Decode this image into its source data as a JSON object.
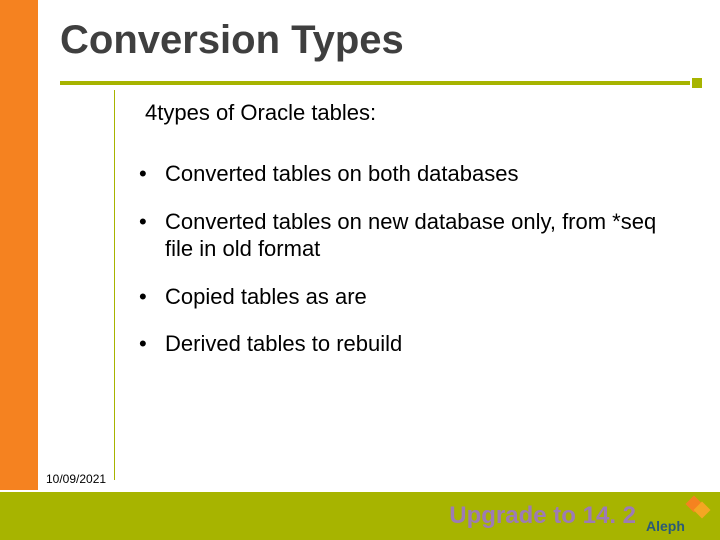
{
  "title": "Conversion Types",
  "intro_prefix": "4",
  "intro_rest": "types of Oracle tables:",
  "bullets": [
    "Converted tables on both databases",
    "Converted tables on new database only, from *seq file in old format",
    "Copied tables as are",
    "Derived tables to rebuild"
  ],
  "footer": {
    "date": "10/09/2021",
    "tagline": "Upgrade to 14. 2",
    "logo_text": "Aleph"
  },
  "colors": {
    "orange": "#f58220",
    "olive": "#a7b400",
    "purple": "#9d7bb5"
  }
}
